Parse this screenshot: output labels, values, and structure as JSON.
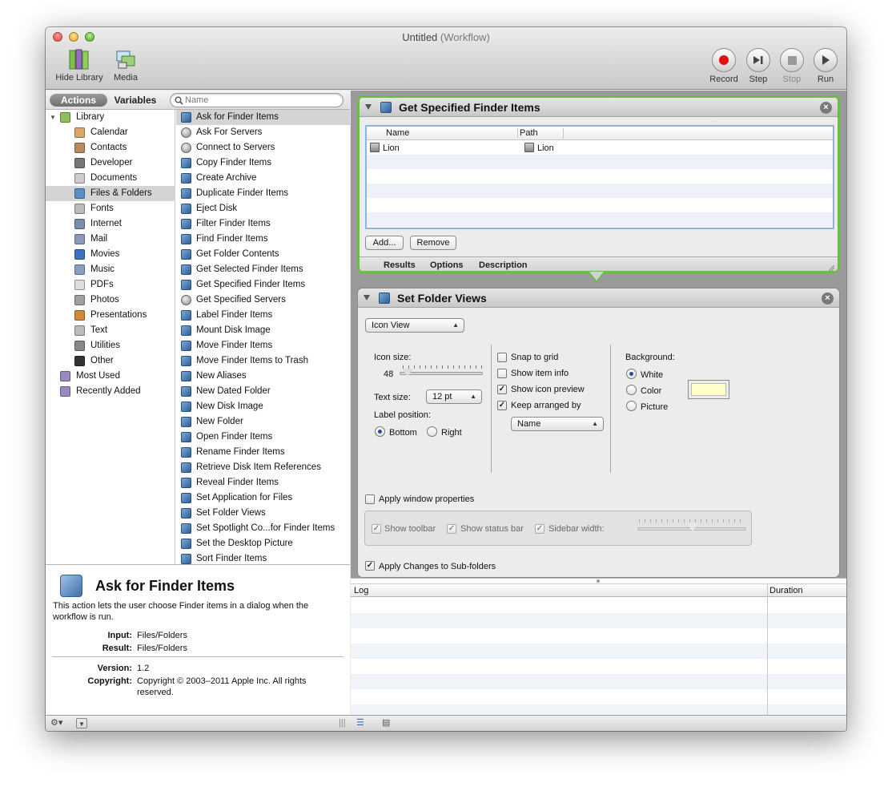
{
  "window": {
    "title": "Untitled",
    "subtitle": "(Workflow)"
  },
  "toolbar": {
    "hide_library": "Hide Library",
    "media": "Media",
    "record": "Record",
    "step": "Step",
    "stop": "Stop",
    "run": "Run"
  },
  "library_header": {
    "actions_tab": "Actions",
    "variables_tab": "Variables",
    "search_placeholder": "Name"
  },
  "categories": [
    {
      "label": "Library",
      "icon": "library-icon",
      "color": "#8fbf5a"
    },
    {
      "label": "Calendar",
      "icon": "calendar-icon",
      "color": "#d9a86a"
    },
    {
      "label": "Contacts",
      "icon": "contacts-icon",
      "color": "#b88a5c"
    },
    {
      "label": "Developer",
      "icon": "developer-icon",
      "color": "#777777"
    },
    {
      "label": "Documents",
      "icon": "documents-icon",
      "color": "#cccccc"
    },
    {
      "label": "Files & Folders",
      "icon": "finder-icon",
      "color": "#5b8fc7"
    },
    {
      "label": "Fonts",
      "icon": "fonts-icon",
      "color": "#bbbbbb"
    },
    {
      "label": "Internet",
      "icon": "internet-icon",
      "color": "#7a8fb0"
    },
    {
      "label": "Mail",
      "icon": "mail-icon",
      "color": "#8a9bb8"
    },
    {
      "label": "Movies",
      "icon": "movies-icon",
      "color": "#3a72c4"
    },
    {
      "label": "Music",
      "icon": "music-icon",
      "color": "#8aa0c0"
    },
    {
      "label": "PDFs",
      "icon": "pdf-icon",
      "color": "#dddddd"
    },
    {
      "label": "Photos",
      "icon": "photos-icon",
      "color": "#a0a0a0"
    },
    {
      "label": "Presentations",
      "icon": "presentations-icon",
      "color": "#d08a3a"
    },
    {
      "label": "Text",
      "icon": "text-icon",
      "color": "#bbbbbb"
    },
    {
      "label": "Utilities",
      "icon": "utilities-icon",
      "color": "#888888"
    },
    {
      "label": "Other",
      "icon": "other-icon",
      "color": "#333333"
    },
    {
      "label": "Most Used",
      "icon": "smart-folder-icon",
      "color": "#9b8ac0"
    },
    {
      "label": "Recently Added",
      "icon": "smart-folder-icon",
      "color": "#9b8ac0"
    }
  ],
  "actions": [
    "Ask for Finder Items",
    "Ask For Servers",
    "Connect to Servers",
    "Copy Finder Items",
    "Create Archive",
    "Duplicate Finder Items",
    "Eject Disk",
    "Filter Finder Items",
    "Find Finder Items",
    "Get Folder Contents",
    "Get Selected Finder Items",
    "Get Specified Finder Items",
    "Get Specified Servers",
    "Label Finder Items",
    "Mount Disk Image",
    "Move Finder Items",
    "Move Finder Items to Trash",
    "New Aliases",
    "New Dated Folder",
    "New Disk Image",
    "New Folder",
    "Open Finder Items",
    "Rename Finder Items",
    "Retrieve Disk Item References",
    "Reveal Finder Items",
    "Set Application for Files",
    "Set Folder Views",
    "Set Spotlight Co...for Finder Items",
    "Set the Desktop Picture",
    "Sort Finder Items"
  ],
  "description": {
    "title": "Ask for Finder Items",
    "text": "This action lets the user choose Finder items in a dialog when the workflow is run.",
    "input_label": "Input:",
    "input_value": "Files/Folders",
    "result_label": "Result:",
    "result_value": "Files/Folders",
    "version_label": "Version:",
    "version_value": "1.2",
    "copyright_label": "Copyright:",
    "copyright_value": "Copyright © 2003–2011 Apple Inc.  All rights reserved."
  },
  "action1": {
    "title": "Get Specified Finder Items",
    "col_name": "Name",
    "col_path": "Path",
    "rows": [
      {
        "name": "Lion",
        "path": "Lion"
      }
    ],
    "add_label": "Add...",
    "remove_label": "Remove",
    "tabs": [
      "Results",
      "Options",
      "Description"
    ]
  },
  "action2": {
    "title": "Set Folder Views",
    "view_popup": "Icon View",
    "icon_size_label": "Icon size:",
    "icon_size_value": "48",
    "text_size_label": "Text size:",
    "text_size_value": "12 pt",
    "label_position_label": "Label position:",
    "bottom_label": "Bottom",
    "right_label": "Right",
    "snap_label": "Snap to grid",
    "item_info_label": "Show item info",
    "icon_preview_label": "Show icon preview",
    "keep_arranged_label": "Keep arranged by",
    "arrange_popup": "Name",
    "background_label": "Background:",
    "white_label": "White",
    "color_label": "Color",
    "picture_label": "Picture",
    "swatch_color": "#ffffc7",
    "apply_window_label": "Apply window properties",
    "show_toolbar_label": "Show toolbar",
    "show_status_label": "Show status bar",
    "sidebar_width_label": "Sidebar width:",
    "apply_sub_label": "Apply Changes to Sub-folders",
    "checkbox_mark": "✓"
  },
  "log": {
    "col_log": "Log",
    "col_duration": "Duration"
  }
}
